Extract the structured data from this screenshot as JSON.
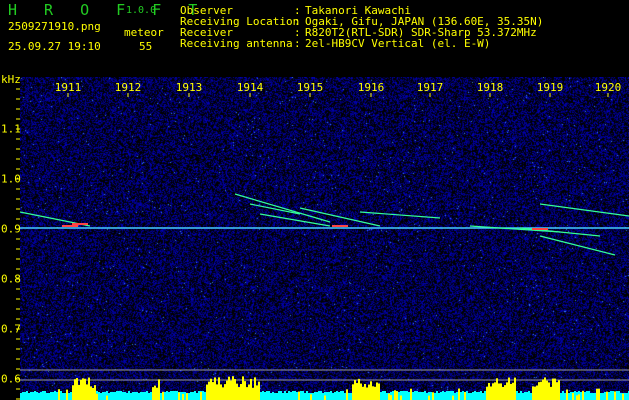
{
  "app": {
    "name": "H R O F F T",
    "version": "1.0.0"
  },
  "file": {
    "name": "2509271910.png",
    "datetime": "25.09.27 19:10"
  },
  "count": {
    "label": "meteor",
    "value": "55"
  },
  "info": [
    {
      "label": "Observer",
      "value": "Takanori Kawachi"
    },
    {
      "label": "Receiving Location",
      "value": "Ogaki, Gifu, JAPAN (136.60E, 35.35N)"
    },
    {
      "label": "Receiver",
      "value": "R820T2(RTL-SDR) SDR-Sharp 53.372MHz"
    },
    {
      "label": "Receiving antenna",
      "value": "2el-HB9CV Vertical (el. E-W)"
    }
  ],
  "axis": {
    "y_unit": "kHz",
    "x_ticks": [
      "1911",
      "1912",
      "1913",
      "1914",
      "1915",
      "1916",
      "1917",
      "1918",
      "1919",
      "1920"
    ],
    "y_ticks": [
      "1.1",
      "1.0",
      "0.9",
      "0.8",
      "0.7",
      "0.6"
    ]
  },
  "colors": {
    "text": "#ffff00",
    "title": "#22cc22",
    "noise": "#1a1aa0",
    "bars": "#ffff00",
    "baseline": "#00ffff"
  }
}
